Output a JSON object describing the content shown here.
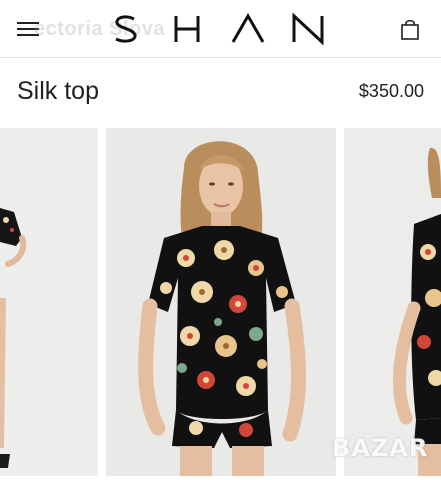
{
  "header": {
    "brand": "SHAN",
    "watermark": "ectoria Slova"
  },
  "product": {
    "title": "Silk top",
    "price": "$350.00"
  },
  "overlay": {
    "marketplace_watermark": "BAZAR"
  },
  "icons": {
    "menu": "hamburger-menu-icon",
    "cart": "shopping-bag-icon"
  },
  "colors": {
    "background": "#ffffff",
    "text": "#222222",
    "divider": "#e6e6e6",
    "print_base": "#111111",
    "print_flower_cream": "#f0d9a8",
    "print_flower_red": "#d2473a",
    "print_leaf": "#7fa78a"
  }
}
